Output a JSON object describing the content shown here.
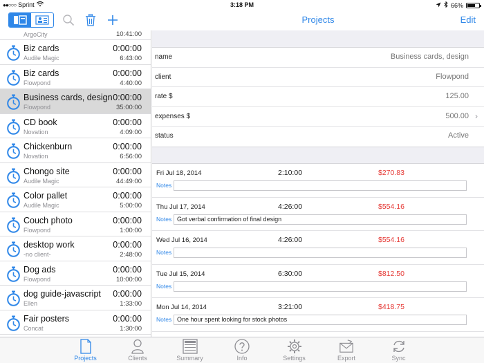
{
  "status": {
    "carrier": "Sprint",
    "time": "3:18 PM",
    "battery": "66%",
    "battery_level": 0.66
  },
  "nav": {
    "title": "Projects",
    "edit": "Edit"
  },
  "projects": [
    {
      "name": "",
      "client": "ArgoCity",
      "time": "",
      "total": "10:41:00"
    },
    {
      "name": "Biz cards",
      "client": "Audile Magic",
      "time": "0:00:00",
      "total": "6:43:00"
    },
    {
      "name": "Biz cards",
      "client": "Flowpond",
      "time": "0:00:00",
      "total": "4:40:00"
    },
    {
      "name": "Business cards, design",
      "client": "Flowpond",
      "time": "0:00:00",
      "total": "35:00:00"
    },
    {
      "name": "CD book",
      "client": "Novation",
      "time": "0:00:00",
      "total": "4:09:00"
    },
    {
      "name": "Chickenburn",
      "client": "Novation",
      "time": "0:00:00",
      "total": "6:56:00"
    },
    {
      "name": "Chongo site",
      "client": "Audile Magic",
      "time": "0:00:00",
      "total": "44:49:00"
    },
    {
      "name": "Color pallet",
      "client": "Audile Magic",
      "time": "0:00:00",
      "total": "5:00:00"
    },
    {
      "name": "Couch photo",
      "client": "Flowpond",
      "time": "0:00:00",
      "total": "1:00:00"
    },
    {
      "name": "desktop work",
      "client": "-no client-",
      "time": "0:00:00",
      "total": "2:48:00"
    },
    {
      "name": "Dog ads",
      "client": "Flowpond",
      "time": "0:00:00",
      "total": "10:00:00"
    },
    {
      "name": "dog guide-javascript",
      "client": "Ellen",
      "time": "0:00:00",
      "total": "1:33:00"
    },
    {
      "name": "Fair posters",
      "client": "Concat",
      "time": "0:00:00",
      "total": "1:30:00"
    }
  ],
  "details": {
    "name": {
      "label": "name",
      "value": "Business cards, design"
    },
    "client": {
      "label": "client",
      "value": "Flowpond"
    },
    "rate": {
      "label": "rate $",
      "value": "125.00"
    },
    "expenses": {
      "label": "expenses $",
      "value": "500.00"
    },
    "status": {
      "label": "status",
      "value": "Active"
    }
  },
  "entries": [
    {
      "date": "Fri Jul 18, 2014",
      "duration": "2:10:00",
      "amount": "$270.83",
      "notes_label": "Notes",
      "notes": ""
    },
    {
      "date": "Thu Jul 17, 2014",
      "duration": "4:26:00",
      "amount": "$554.16",
      "notes_label": "Notes",
      "notes": "Got verbal confirmation of final design"
    },
    {
      "date": "Wed Jul 16, 2014",
      "duration": "4:26:00",
      "amount": "$554.16",
      "notes_label": "Notes",
      "notes": ""
    },
    {
      "date": "Tue Jul 15, 2014",
      "duration": "6:30:00",
      "amount": "$812.50",
      "notes_label": "Notes",
      "notes": ""
    },
    {
      "date": "Mon Jul 14, 2014",
      "duration": "3:21:00",
      "amount": "$418.75",
      "notes_label": "Notes",
      "notes": "One hour spent looking for stock photos"
    }
  ],
  "tabs": [
    {
      "label": "Projects",
      "icon": "document-icon",
      "active": true
    },
    {
      "label": "Clients",
      "icon": "person-icon",
      "active": false
    },
    {
      "label": "Summary",
      "icon": "summary-icon",
      "active": false
    },
    {
      "label": "Info",
      "icon": "info-icon",
      "active": false
    },
    {
      "label": "Settings",
      "icon": "gear-icon",
      "active": false
    },
    {
      "label": "Export",
      "icon": "envelope-icon",
      "active": false
    },
    {
      "label": "Sync",
      "icon": "sync-icon",
      "active": false
    }
  ],
  "colors": {
    "accent": "#2f87e8",
    "amount": "#e53935",
    "selected_row": "#d9d9d9"
  }
}
